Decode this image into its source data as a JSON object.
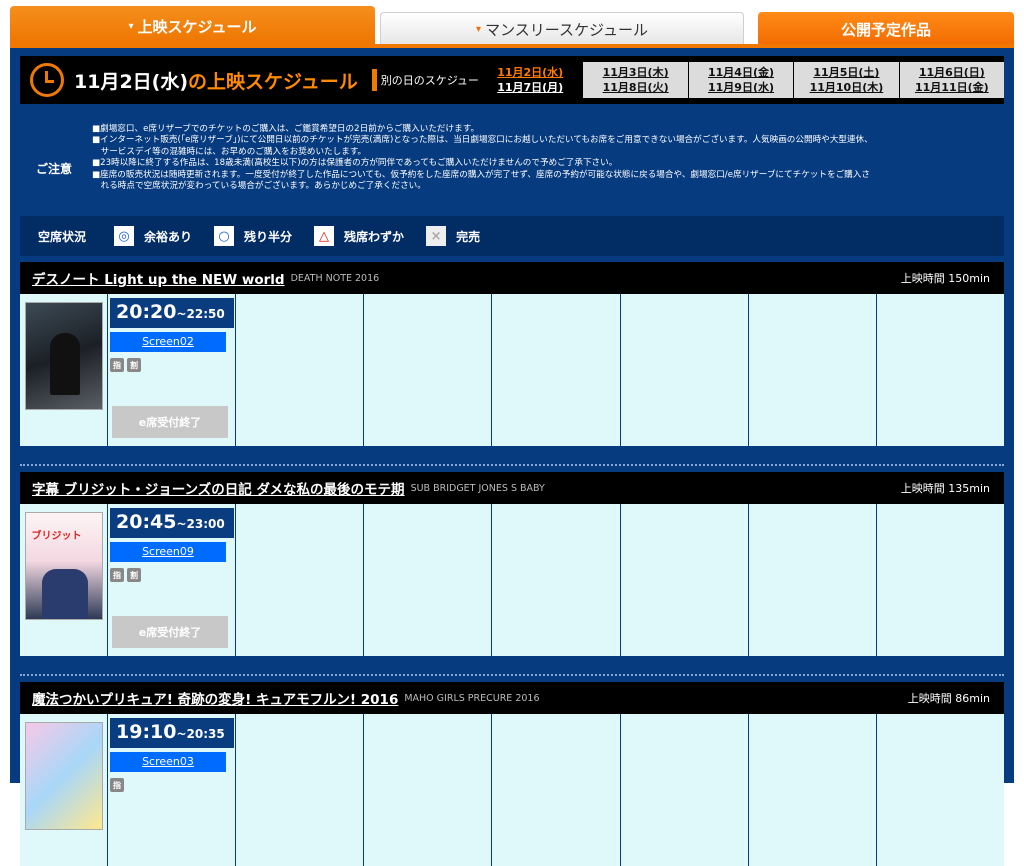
{
  "tabs": [
    {
      "label": "上映スケジュール",
      "arrow": "▾"
    },
    {
      "label": "マンスリースケジュール",
      "arrow": "▾"
    },
    {
      "label": "公開予定作品"
    }
  ],
  "date_bar": {
    "title_black": "11月2日(水)",
    "title_orange": "の上映スケジュール",
    "other_label": "別の日のスケジュール",
    "dates": [
      {
        "top": "11月2日(水)",
        "bottom": "11月7日(月)"
      },
      {
        "top": "11月3日(木)",
        "bottom": "11月8日(火)"
      },
      {
        "top": "11月4日(金)",
        "bottom": "11月9日(水)"
      },
      {
        "top": "11月5日(土)",
        "bottom": "11月10日(木)"
      },
      {
        "top": "11月6日(日)",
        "bottom": "11月11日(金)"
      }
    ]
  },
  "notes": {
    "label": "ご注意",
    "lines": [
      "■劇場窓口、e席リザーブでのチケットのご購入は、ご鑑賞希望日の2日前からご購入いただけます。",
      "■インターネット販売(「e席リザーブ」)にて公開日以前のチケットが完売(満席)となった際は、当日劇場窓口にお越しいただいてもお席をご用意できない場合がございます。人気映画の公開時や大型連休、",
      "　サービスデイ等の混雑時には、お早めのご購入をお奨めいたします。",
      "■23時以降に終了する作品は、18歳未満(高校生以下)の方は保護者の方が同伴であってもご購入いただけませんので予めご了承下さい。",
      "■座席の販売状況は随時更新されます。一度受付が終了した作品についても、仮予約をした座席の購入が完了せず、座席の予約が可能な状態に戻る場合や、劇場窓口/e席リザーブにてチケットをご購入さ",
      "　れる時点で空席状況が変わっている場合がございます。あらかじめご了承ください。"
    ]
  },
  "legend": {
    "title": "空席状況",
    "items": [
      {
        "symbol": "◎",
        "label": "余裕あり"
      },
      {
        "symbol": "○",
        "label": "残り半分"
      },
      {
        "symbol": "△",
        "label": "残席わずか"
      },
      {
        "symbol": "×",
        "label": "完売"
      }
    ]
  },
  "movies": [
    {
      "title": "デスノート Light up the NEW world",
      "subtitle": "DEATH NOTE 2016",
      "runtime": "上映時間 150min",
      "start": "20:20",
      "end": "~22:50",
      "screen": "Screen02",
      "icon1": "指",
      "icon2": "割",
      "eseat": "e席受付終了",
      "poster_text": ""
    },
    {
      "title": "字幕 ブリジット・ジョーンズの日記 ダメな私の最後のモテ期",
      "subtitle": "SUB BRIDGET JONES S BABY",
      "runtime": "上映時間 135min",
      "start": "20:45",
      "end": "~23:00",
      "screen": "Screen09",
      "icon1": "指",
      "icon2": "割",
      "eseat": "e席受付終了",
      "poster_text": "ブリジット"
    },
    {
      "title": "魔法つかいプリキュア! 奇跡の変身! キュアモフルン! 2016",
      "subtitle": "MAHO GIRLS PRECURE 2016",
      "runtime": "上映時間 86min",
      "start": "19:10",
      "end": "~20:35",
      "screen": "Screen03",
      "icon1": "指",
      "icon2": "",
      "eseat": "",
      "poster_text": ""
    }
  ]
}
